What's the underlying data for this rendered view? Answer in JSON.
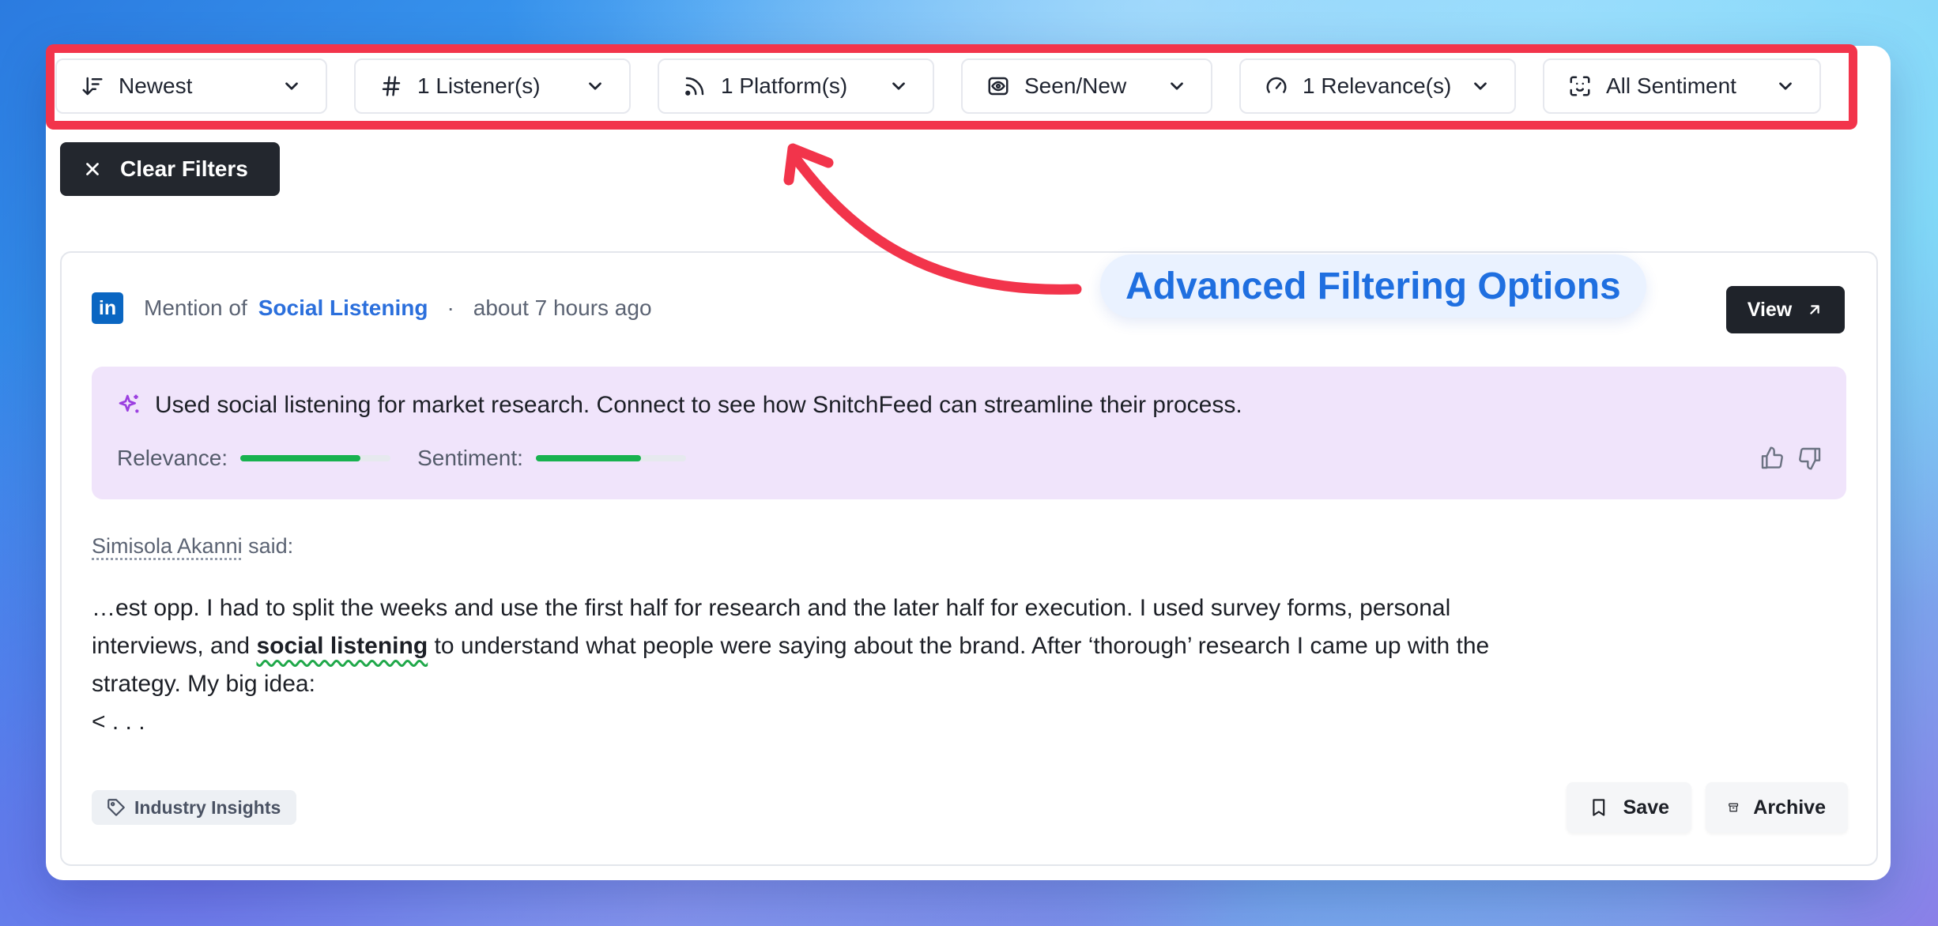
{
  "filters": [
    {
      "label": "Newest",
      "icon": "sort-icon"
    },
    {
      "label": "1 Listener(s)",
      "icon": "hash-icon"
    },
    {
      "label": "1 Platform(s)",
      "icon": "rss-icon"
    },
    {
      "label": "Seen/New",
      "icon": "eye-icon"
    },
    {
      "label": "1 Relevance(s)",
      "icon": "gauge-icon"
    },
    {
      "label": "All Sentiment",
      "icon": "face-scan-icon"
    }
  ],
  "clear_filters_label": "Clear Filters",
  "annotation": {
    "text": "Advanced Filtering Options",
    "color": "#1f6fe0",
    "arrow_color": "#f2344b"
  },
  "mention": {
    "platform_logo": "in",
    "prefix": "Mention of",
    "listener": "Social Listening",
    "separator": "·",
    "time": "about 7 hours ago",
    "view_label": "View",
    "summary": "Used social listening for market research. Connect to see how SnitchFeed can streamline their process.",
    "relevance_label": "Relevance:",
    "relevance": 0.8,
    "sentiment_label": "Sentiment:",
    "sentiment": 0.7,
    "author": "Simisola Akanni",
    "said": "said:",
    "text_before": "…est opp. I had to split the weeks and use the first half for research and the later half for execution. I used survey forms, personal interviews, and ",
    "keyword": "social listening",
    "text_after": " to understand what people were saying about the brand. After ‘thorough’ research I came up with the strategy. My big idea:",
    "text_tail": "< . . .",
    "tag": "Industry Insights",
    "save_label": "Save",
    "archive_label": "Archive"
  },
  "colors": {
    "accent_blue": "#2b6fdc",
    "bar_green": "#18b24f",
    "summary_bg": "#f0e4fb",
    "dark_button": "#23272e"
  }
}
